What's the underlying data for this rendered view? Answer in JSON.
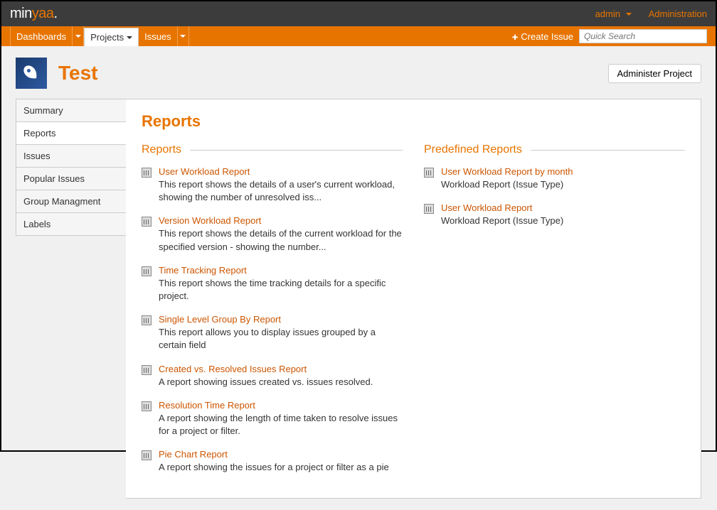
{
  "brand": {
    "part1": "min",
    "part2": "yaa",
    "dot": "."
  },
  "topRight": {
    "admin": "admin",
    "administration": "Administration"
  },
  "nav": {
    "dashboards": "Dashboards",
    "projects": "Projects",
    "issues": "Issues",
    "createIssue": "Create Issue",
    "searchPlaceholder": "Quick Search"
  },
  "project": {
    "title": "Test",
    "adminBtn": "Administer Project"
  },
  "sidebar": {
    "items": [
      {
        "label": "Summary",
        "active": false
      },
      {
        "label": "Reports",
        "active": true
      },
      {
        "label": "Issues",
        "active": false
      },
      {
        "label": "Popular Issues",
        "active": false
      },
      {
        "label": "Group Managment",
        "active": false
      },
      {
        "label": "Labels",
        "active": false
      }
    ]
  },
  "panel": {
    "title": "Reports",
    "sections": {
      "reports": "Reports",
      "predefined": "Predefined Reports"
    },
    "reportsList": [
      {
        "title": "User Workload Report",
        "desc": "This report shows the details of a user's current workload, showing the number of unresolved iss..."
      },
      {
        "title": "Version Workload Report",
        "desc": "This report shows the details of the current workload for the specified version - showing the number..."
      },
      {
        "title": "Time Tracking Report",
        "desc": "This report shows the time tracking details for a specific project."
      },
      {
        "title": "Single Level Group By Report",
        "desc": "This report allows you to display issues grouped by a certain field"
      },
      {
        "title": "Created vs. Resolved Issues Report",
        "desc": "A report showing issues created vs. issues resolved."
      },
      {
        "title": "Resolution Time Report",
        "desc": "A report showing the length of time taken to resolve issues for a project or filter."
      },
      {
        "title": "Pie Chart Report",
        "desc": "A report showing the issues for a project or filter as a pie"
      }
    ],
    "predefinedList": [
      {
        "title": "User Workload Report by month",
        "desc": "Workload Report (Issue Type)"
      },
      {
        "title": "User Workload Report",
        "desc": "Workload Report (Issue Type)"
      }
    ]
  }
}
